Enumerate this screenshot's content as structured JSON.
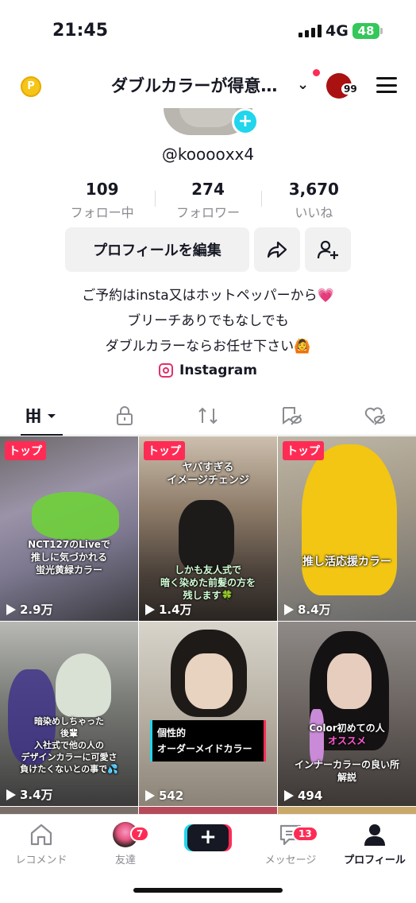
{
  "status": {
    "time": "21:45",
    "network": "4G",
    "battery": "48"
  },
  "header": {
    "title": "ダブルカラーが得意…",
    "avatar_badge": "99"
  },
  "profile": {
    "username": "@koooоxx4",
    "stats": [
      {
        "value": "109",
        "label": "フォロー中"
      },
      {
        "value": "274",
        "label": "フォロワー"
      },
      {
        "value": "3,670",
        "label": "いいね"
      }
    ],
    "edit_label": "プロフィールを編集",
    "bio": [
      "ご予約はinsta又はホットペッパーから💗",
      "ブリーチありでもなしでも",
      "ダブルカラーならお任せ下さい🙆"
    ],
    "link_label": "Instagram"
  },
  "videos": [
    {
      "badge": "トップ",
      "views": "2.9万",
      "caption": "NCT127のLiveで\n推しに気づかれる\n蛍光黄緑カラー"
    },
    {
      "badge": "トップ",
      "views": "1.4万",
      "caption": "ヤバすぎる\nイメージチェンジ",
      "caption2": "しかも友人式で\n暗く染めた前髪の方を\n残します🍀"
    },
    {
      "badge": "トップ",
      "views": "8.4万",
      "caption": "推し活応援カラー"
    },
    {
      "views": "3.4万",
      "caption": "暗染めしちゃった\n後輩\n入社式で他の人の\nデザインカラーに可愛さ\n負けたくないとの事で💦"
    },
    {
      "views": "542",
      "caption": "個性的\nオーダーメイドカラー"
    },
    {
      "views": "494",
      "caption": "Color初めての人",
      "caption_highlight": "オススメ",
      "caption2": "インナーカラーの良い所\n解説"
    }
  ],
  "nav": {
    "home": "レコメンド",
    "friends": "友達",
    "friends_badge": "7",
    "inbox": "メッセージ",
    "inbox_badge": "13",
    "profile": "プロフィール"
  },
  "colors": {
    "accent": "#fe2c55",
    "cyan": "#20d5ec"
  }
}
